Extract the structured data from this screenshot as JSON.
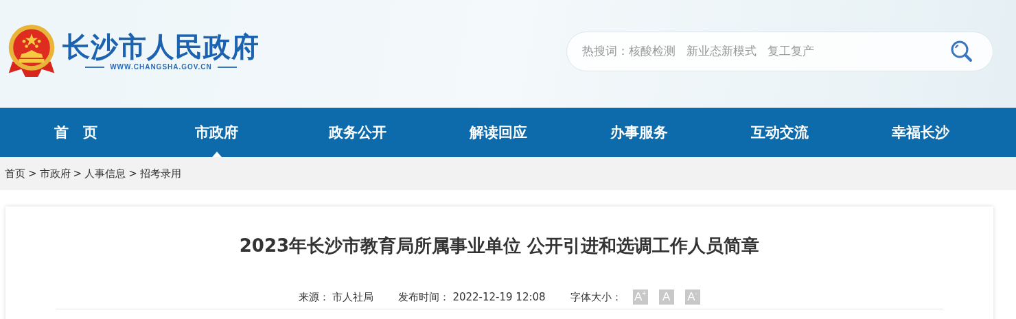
{
  "header": {
    "site_name": "长沙市人民政府",
    "site_url": "WWW.CHANGSHA.GOV.CN",
    "search": {
      "label": "热搜词：",
      "hot_words": [
        "核酸检测",
        "新业态新模式",
        "复工复产"
      ]
    }
  },
  "nav": [
    {
      "label": "首　页",
      "selected": false
    },
    {
      "label": "市政府",
      "selected": true
    },
    {
      "label": "政务公开",
      "selected": false
    },
    {
      "label": "解读回应",
      "selected": false
    },
    {
      "label": "办事服务",
      "selected": false
    },
    {
      "label": "互动交流",
      "selected": false
    },
    {
      "label": "幸福长沙",
      "selected": false
    }
  ],
  "breadcrumb": {
    "items": [
      "首页",
      "市政府",
      "人事信息",
      "招考录用"
    ],
    "separator": ">"
  },
  "article": {
    "title": "2023年长沙市教育局所属事业单位 公开引进和选调工作人员简章",
    "meta": [
      {
        "label": "来源：",
        "value": "市人社局"
      },
      {
        "label": "发布时间：",
        "value": "2022-12-19 12:08"
      }
    ],
    "font_size": {
      "label": "字体大小：",
      "buttons": [
        "A$^{+}$",
        "A",
        "A$^{-}$"
      ]
    }
  }
}
